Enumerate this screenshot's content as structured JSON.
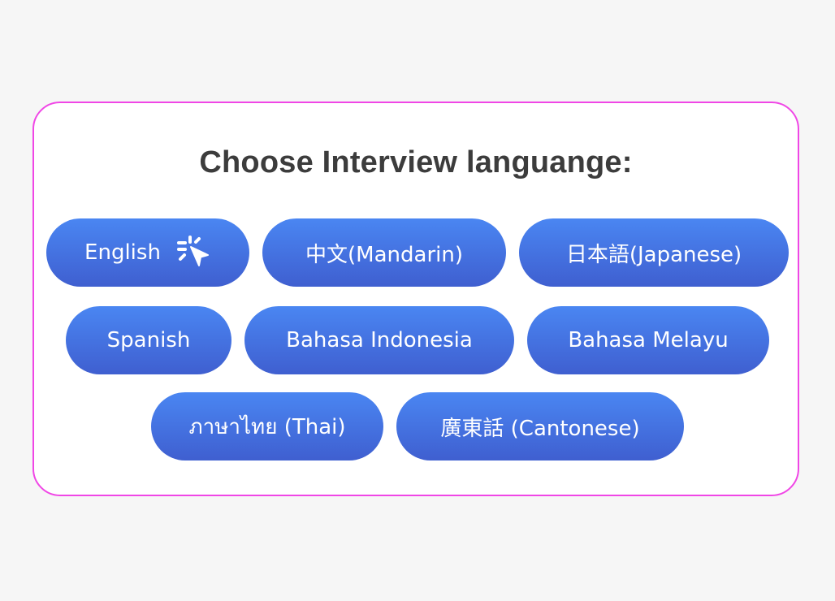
{
  "title": "Choose Interview languange:",
  "languages": [
    {
      "label": "English"
    },
    {
      "label": "中文(Mandarin)"
    },
    {
      "label": "日本語(Japanese)"
    },
    {
      "label": "Spanish"
    },
    {
      "label": "Bahasa Indonesia"
    },
    {
      "label": "Bahasa Melayu"
    },
    {
      "label": "ภาษาไทย (Thai)"
    },
    {
      "label": "廣東話 (Cantonese)"
    }
  ],
  "icons": {
    "pointer": "click-cursor-icon"
  },
  "colors": {
    "background": "#f6f6f6",
    "card_border": "#f046e6",
    "button_top": "#4a86f2",
    "button_bottom": "#3f5fd0",
    "title": "#3c3c3c"
  }
}
